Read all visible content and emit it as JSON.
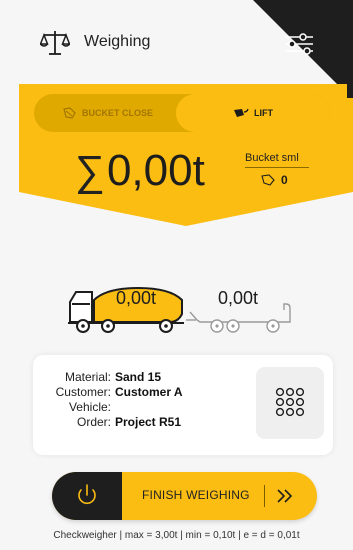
{
  "header": {
    "title": "Weighing",
    "icons": {
      "scale": "scale-icon",
      "settings": "filter-sliders-icon"
    }
  },
  "mode_toggle": {
    "options": [
      {
        "label": "BUCKET CLOSE",
        "icon": "bucket-icon",
        "selected": false
      },
      {
        "label": "LIFT",
        "icon": "bucket-lift-icon",
        "selected": true
      }
    ]
  },
  "summary": {
    "total_value": "0,00t",
    "bucket_label": "Bucket sml",
    "bucket_count": "0"
  },
  "trucks": {
    "truck_weight": "0,00t",
    "trailer_weight": "0,00t"
  },
  "info": {
    "rows": [
      {
        "label": "Material:",
        "value": "Sand 15"
      },
      {
        "label": "Customer:",
        "value": "Customer A"
      },
      {
        "label": "Vehicle:",
        "value": ""
      },
      {
        "label": "Order:",
        "value": "Project R51"
      }
    ]
  },
  "actions": {
    "finish_label": "FINISH WEIGHING"
  },
  "footer": {
    "text": "Checkweigher | max = 3,00t | min = 0,10t | e = d = 0,01t"
  },
  "colors": {
    "accent": "#fbbd12",
    "dark": "#1e1e1e",
    "toggle_track": "#e0a900"
  }
}
